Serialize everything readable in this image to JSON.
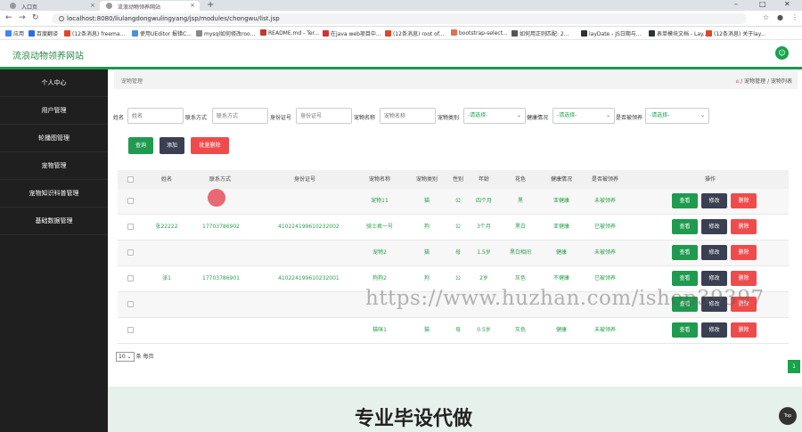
{
  "browser": {
    "tabs": [
      {
        "title": "入口页",
        "active": false
      },
      {
        "title": "流浪动物领养网站",
        "active": true
      }
    ],
    "new_tab": "+",
    "window_controls": [
      "–",
      "□",
      "✕"
    ],
    "url": "localhost:8080/liulangdongwulingyang/jsp/modules/chongwu/list.jsp",
    "bookmarks": [
      {
        "label": "应用",
        "color": "#4285f4"
      },
      {
        "label": "百度翻译",
        "color": "#2b6de8"
      },
      {
        "label": "(12条消息) freema...",
        "color": "#e0452b"
      },
      {
        "label": "使用UEditor 报错C...",
        "color": "#4a90d9"
      },
      {
        "label": "mysql如何修改roo...",
        "color": "#888888"
      },
      {
        "label": "README.md - Ter...",
        "color": "#c0392b"
      },
      {
        "label": "在java web项目中...",
        "color": "#d63031"
      },
      {
        "label": "(12条消息) root of...",
        "color": "#e0452b"
      },
      {
        "label": "bootstrap-select...",
        "color": "#e17055"
      },
      {
        "label": "如何用正则匹配: 2...",
        "color": "#555555"
      },
      {
        "label": "layDate - JS日期与...",
        "color": "#2d3436"
      },
      {
        "label": "表单模块文档 - Lay...",
        "color": "#2d3436"
      },
      {
        "label": "(12条消息) 关于lay...",
        "color": "#e0452b"
      }
    ]
  },
  "app": {
    "title": "流浪动物领养网站",
    "accent": "#1a9a4a"
  },
  "sidebar": {
    "items": [
      {
        "label": "个人中心"
      },
      {
        "label": "用户管理"
      },
      {
        "label": "轮播图管理"
      },
      {
        "label": "宠物管理"
      },
      {
        "label": "宠物知识科普管理"
      },
      {
        "label": "基础数据管理"
      }
    ]
  },
  "breadcrumb": {
    "page_title": "宠物管理",
    "path": "/ 宠物管理 / 宠物列表",
    "home_icon": "home-icon"
  },
  "filters": {
    "name": {
      "label": "姓名",
      "placeholder": "姓名"
    },
    "phone": {
      "label": "联系方式",
      "placeholder": "联系方式"
    },
    "idcard": {
      "label": "身份证号",
      "placeholder": "身份证号"
    },
    "pet_name": {
      "label": "宠物名称",
      "placeholder": "宠物名称"
    },
    "pet_type": {
      "label": "宠物类别",
      "value": "-请选择-"
    },
    "health": {
      "label": "健康情况",
      "value": "-请选择-"
    },
    "adopted": {
      "label": "是否被领养",
      "value": "-请选择-"
    }
  },
  "buttons": {
    "search": "查询",
    "add": "添加",
    "batch_delete": "批量删除"
  },
  "table": {
    "headers": [
      "姓名",
      "联系方式",
      "身份证号",
      "宠物名称",
      "宠物类别",
      "性别",
      "年龄",
      "花色",
      "健康情况",
      "是否被领养",
      "操作"
    ],
    "rows": [
      {
        "name": "",
        "phone": "",
        "idcard": "",
        "pet_name": "宠物11",
        "type": "猫",
        "sex": "公",
        "age": "四个月",
        "color": "黑",
        "health": "亚健康",
        "adopted": "未被领养"
      },
      {
        "name": "张22222",
        "phone": "17703786902",
        "idcard": "410224199610232002",
        "pet_name": "骑士君一号",
        "type": "狗",
        "sex": "公",
        "age": "3个月",
        "color": "黑白",
        "health": "亚健康",
        "adopted": "已被领养"
      },
      {
        "name": "",
        "phone": "",
        "idcard": "",
        "pet_name": "宠物2",
        "type": "猫",
        "sex": "母",
        "age": "1.5岁",
        "color": "黑白相间",
        "health": "健康",
        "adopted": "未被领养"
      },
      {
        "name": "张1",
        "phone": "17703786901",
        "idcard": "410224199610232001",
        "pet_name": "狗狗2",
        "type": "狗",
        "sex": "公",
        "age": "2岁",
        "color": "灰色",
        "health": "不健康",
        "adopted": "已被领养"
      },
      {
        "name": "",
        "phone": "",
        "idcard": "",
        "pet_name": "",
        "type": "",
        "sex": "",
        "age": "",
        "color": "",
        "health": "",
        "adopted": ""
      },
      {
        "name": "",
        "phone": "",
        "idcard": "",
        "pet_name": "猫咪1",
        "type": "猫",
        "sex": "母",
        "age": "0.5岁",
        "color": "灰色",
        "health": "健康",
        "adopted": "未被领养"
      }
    ],
    "actions": {
      "view": "查看",
      "edit": "修改",
      "delete": "删除"
    }
  },
  "pagination": {
    "page_size": "10",
    "page_size_suffix": "条 每页",
    "current_page": "1"
  },
  "watermark": "https://www.huzhan.com/ishop39397",
  "banner": {
    "text": "专业毕设代做"
  },
  "back_to_top": "Top"
}
